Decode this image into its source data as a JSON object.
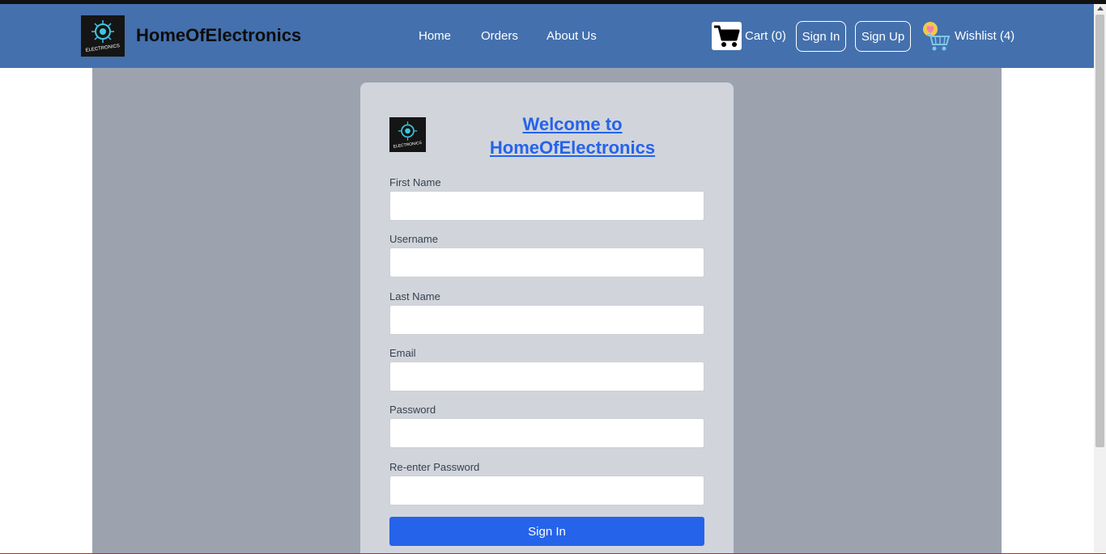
{
  "brand": {
    "name": "HomeOfElectronics",
    "logo_text": "ELECTRONICS"
  },
  "nav": {
    "home": "Home",
    "orders": "Orders",
    "about": "About Us"
  },
  "cart": {
    "label": "Cart (0)",
    "icon": "cart-icon"
  },
  "buttons": {
    "sign_in": "Sign In",
    "sign_up": "Sign Up"
  },
  "wishlist": {
    "label": "Wishlist (4)",
    "icon": "wishlist-cart-heart-icon"
  },
  "form": {
    "title": "Welcome to HomeOfElectronics",
    "fields": [
      {
        "label": "First Name",
        "value": ""
      },
      {
        "label": "Username",
        "value": ""
      },
      {
        "label": "Last Name",
        "value": ""
      },
      {
        "label": "Email",
        "value": ""
      },
      {
        "label": "Password",
        "value": ""
      },
      {
        "label": "Re-enter Password",
        "value": ""
      }
    ],
    "submit_label": "Sign In"
  },
  "colors": {
    "navbar": "#4470ad",
    "backdrop": "#9ca3af",
    "card": "#d1d5db",
    "accent": "#2563eb"
  }
}
